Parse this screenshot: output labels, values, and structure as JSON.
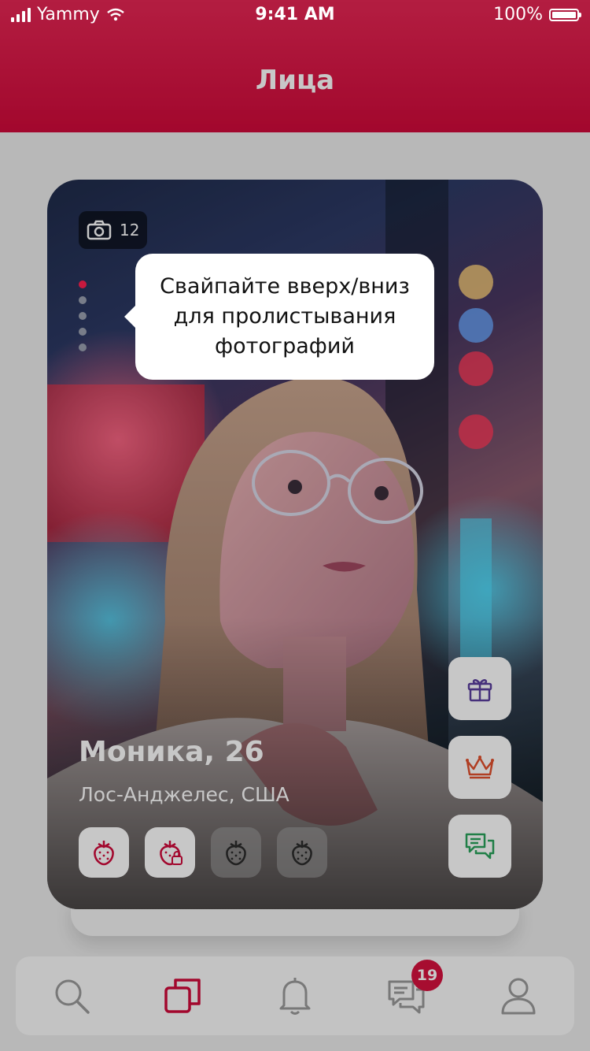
{
  "status": {
    "carrier": "Yammy",
    "time": "9:41 AM",
    "battery": "100%"
  },
  "header": {
    "title": "Лица"
  },
  "profile": {
    "photo_count": "12",
    "name": "Моника, 26",
    "location": "Лос-Анджелес, США",
    "photo_pages": 5,
    "current_photo_page": 1
  },
  "tooltip": {
    "text": "Свайпайте вверх/вниз для пролистывания фотографий"
  },
  "actions": [
    "gift-icon",
    "crown-icon",
    "chat-icon"
  ],
  "tabs": [
    {
      "icon": "search-icon"
    },
    {
      "icon": "cards-icon",
      "active": true
    },
    {
      "icon": "bell-icon"
    },
    {
      "icon": "messages-icon",
      "badge": "19"
    },
    {
      "icon": "profile-icon"
    }
  ],
  "colors": {
    "brand": "#d00a3a",
    "gift": "#5a3e9e",
    "crown": "#e2502d",
    "chat": "#2aa35c"
  }
}
